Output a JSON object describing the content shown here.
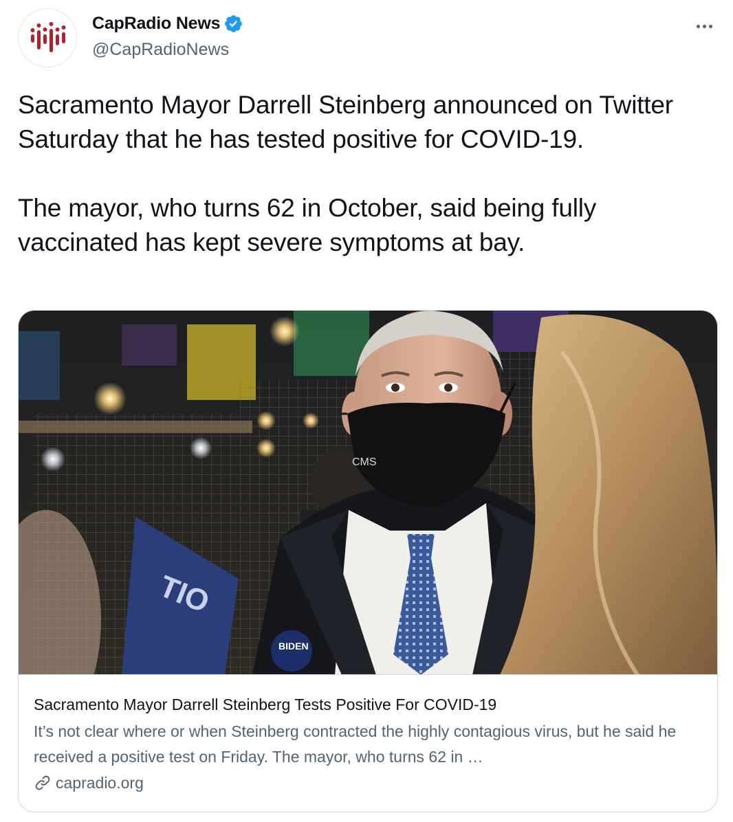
{
  "account": {
    "display_name": "CapRadio News",
    "handle": "@CapRadioNews",
    "verified": true,
    "avatar_icon": "capradio-logo-icon",
    "brand_color": "#b3202b"
  },
  "tweet": {
    "paragraphs": [
      "Sacramento Mayor Darrell Steinberg announced on Twitter Saturday that he has tested positive for COVID-19.",
      "The mayor, who turns 62 in October, said being fully vaccinated has kept severe symptoms at bay."
    ]
  },
  "card": {
    "title": "Sacramento Mayor Darrell Steinberg Tests Positive For COVID-19",
    "description": "It’s not clear where or when Steinberg contracted the highly contagious virus, but he said he received a positive test on Friday. The mayor, who turns 62 in …",
    "domain": "capradio.org",
    "link_icon": "link-icon",
    "image_icon": "news-photo-image"
  },
  "colors": {
    "text_primary": "#0f1419",
    "text_secondary": "#536471",
    "verified_blue": "#1d9bf0",
    "border": "#cfd9de"
  }
}
